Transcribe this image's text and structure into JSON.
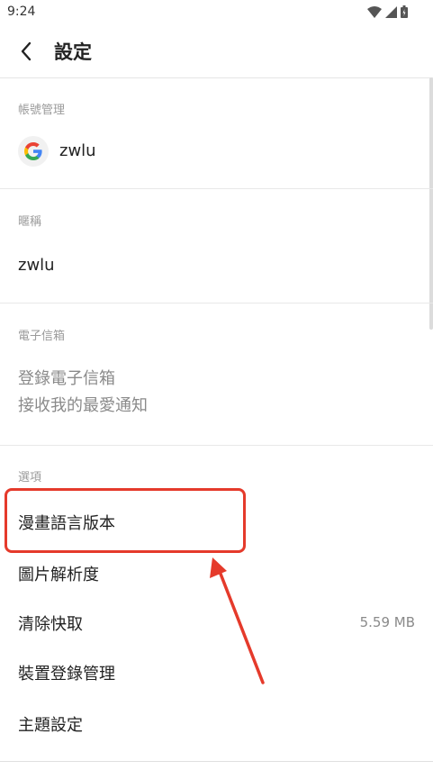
{
  "status_bar": {
    "time": "9:24"
  },
  "header": {
    "title": "設定"
  },
  "account_section": {
    "label": "帳號管理",
    "provider_icon": "google-icon",
    "name": "zwlu"
  },
  "nickname_section": {
    "label": "暱稱",
    "value": "zwlu"
  },
  "email_section": {
    "label": "電子信箱",
    "line1": "登錄電子信箱",
    "line2": "接收我的最愛通知"
  },
  "options_section": {
    "label": "選項",
    "items": [
      {
        "label": "漫畫語言版本"
      },
      {
        "label": "圖片解析度"
      },
      {
        "label": "清除快取",
        "value": "5.59 MB"
      },
      {
        "label": "裝置登錄管理"
      },
      {
        "label": "主題設定"
      }
    ]
  },
  "annotation": {
    "color": "#e53a2b"
  }
}
